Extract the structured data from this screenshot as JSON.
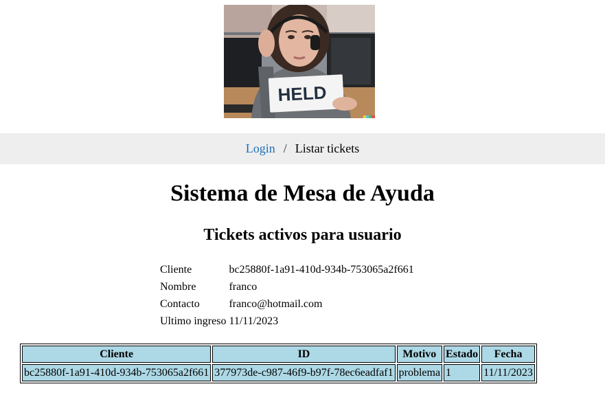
{
  "nav": {
    "login_label": "Login",
    "separator": "/",
    "current_label": "Listar tickets"
  },
  "hero_image": {
    "sign_text": "HELD"
  },
  "page": {
    "title": "Sistema de Mesa de Ayuda",
    "subtitle": "Tickets activos para usuario"
  },
  "user_info": [
    {
      "label": "Cliente",
      "value": "bc25880f-1a91-410d-934b-753065a2f661"
    },
    {
      "label": "Nombre",
      "value": "franco"
    },
    {
      "label": "Contacto",
      "value": "franco@hotmail.com"
    },
    {
      "label": "Ultimo ingreso",
      "value": "11/11/2023"
    }
  ],
  "tickets": {
    "headers": [
      "Cliente",
      "ID",
      "Motivo",
      "Estado",
      "Fecha"
    ],
    "rows": [
      [
        "bc25880f-1a91-410d-934b-753065a2f661",
        "377973de-c987-46f9-b97f-78ec6eadfaf1",
        "problema",
        "1",
        "11/11/2023"
      ]
    ]
  },
  "colors": {
    "table_background": "#add8e6",
    "nav_background": "#eeeeee",
    "link": "#1a6fb8"
  }
}
